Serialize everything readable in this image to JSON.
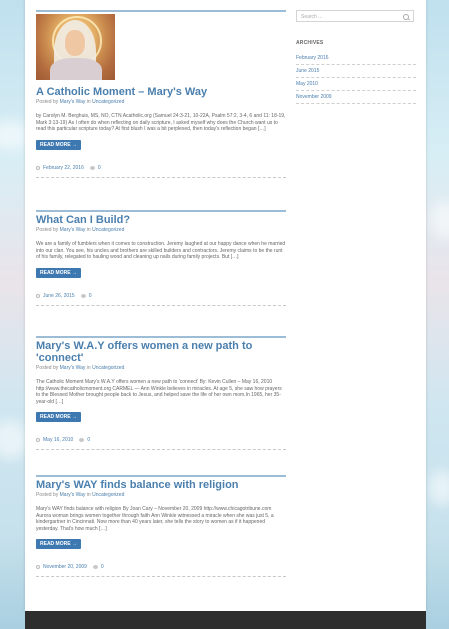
{
  "sidebar": {
    "search_placeholder": "Search ...",
    "archives_title": "ARCHIVES",
    "archives": [
      "February 2016",
      "June 2015",
      "May 2010",
      "November 2009"
    ]
  },
  "posts": [
    {
      "title": "A Catholic Moment – Mary's Way",
      "meta_prefix": "Posted by",
      "author": "Mary's Way",
      "meta_in": "in",
      "category": "Uncategorized",
      "excerpt": "by Carolyn M. Berghuis, MS, NO, CTN Acatholic.org (Samuel 24:3-21, 10-22A, Psalm 57:2, 3-4, 6 and 11: 18-19, Mark 3:13-19) As I often do when reflecting on daily scripture, I asked myself why does the Church want us to read this particular scripture today? At first blush I was a bit perplexed, then today's reflection began […]",
      "more": "READ MORE →",
      "date": "February 22, 2016",
      "comments": "0"
    },
    {
      "title": "What Can I Build?",
      "meta_prefix": "Posted by",
      "author": "Mary's Way",
      "meta_in": "in",
      "category": "Uncategorized",
      "excerpt": "We are a family of fumblers when it comes to construction. Jeremy laughed at our happy dance when he married into our clan. You see, his uncles and brothers are skilled builders and contractors. Jeremy claims to be the runt of his family, relegated to hauling wood and cleaning up nails during family projects. But […]",
      "more": "READ MORE →",
      "date": "June 26, 2015",
      "comments": "0"
    },
    {
      "title": "Mary's W.A.Y offers women a new path to 'connect'",
      "meta_prefix": "Posted by",
      "author": "Mary's Way",
      "meta_in": "in",
      "category": "Uncategorized",
      "excerpt": "The Catholic Moment Mary's W.A.Y offers women a new path to 'connect' By: Kevin Cullen – May 16, 2010 http://www.thecatholicmoment.org CARMEL — Ann Winkle believes in miracles. At age 5, she saw how prayers to the Blessed Mother brought people back to Jesus, and helped save the life of her own mom.In 1965, her 35-year-old […]",
      "more": "READ MORE →",
      "date": "May 16, 2010",
      "comments": "0"
    },
    {
      "title": "Mary's WAY finds balance with religion",
      "meta_prefix": "Posted by",
      "author": "Mary's Way",
      "meta_in": "in",
      "category": "Uncategorized",
      "excerpt": "Mary's WAY finds balance with religion By Joan Cary – November 20, 2009 http://www.chicagotribune.com Aurora woman brings women together through faith Ann Winkle witnessed a miracle when she was just 5, a kindergartner in Cincinnati. Now more than 40 years later, she tells the story to women as if it happened yesterday. That's how much […]",
      "more": "READ MORE →",
      "date": "November 20, 2009",
      "comments": "0"
    }
  ]
}
